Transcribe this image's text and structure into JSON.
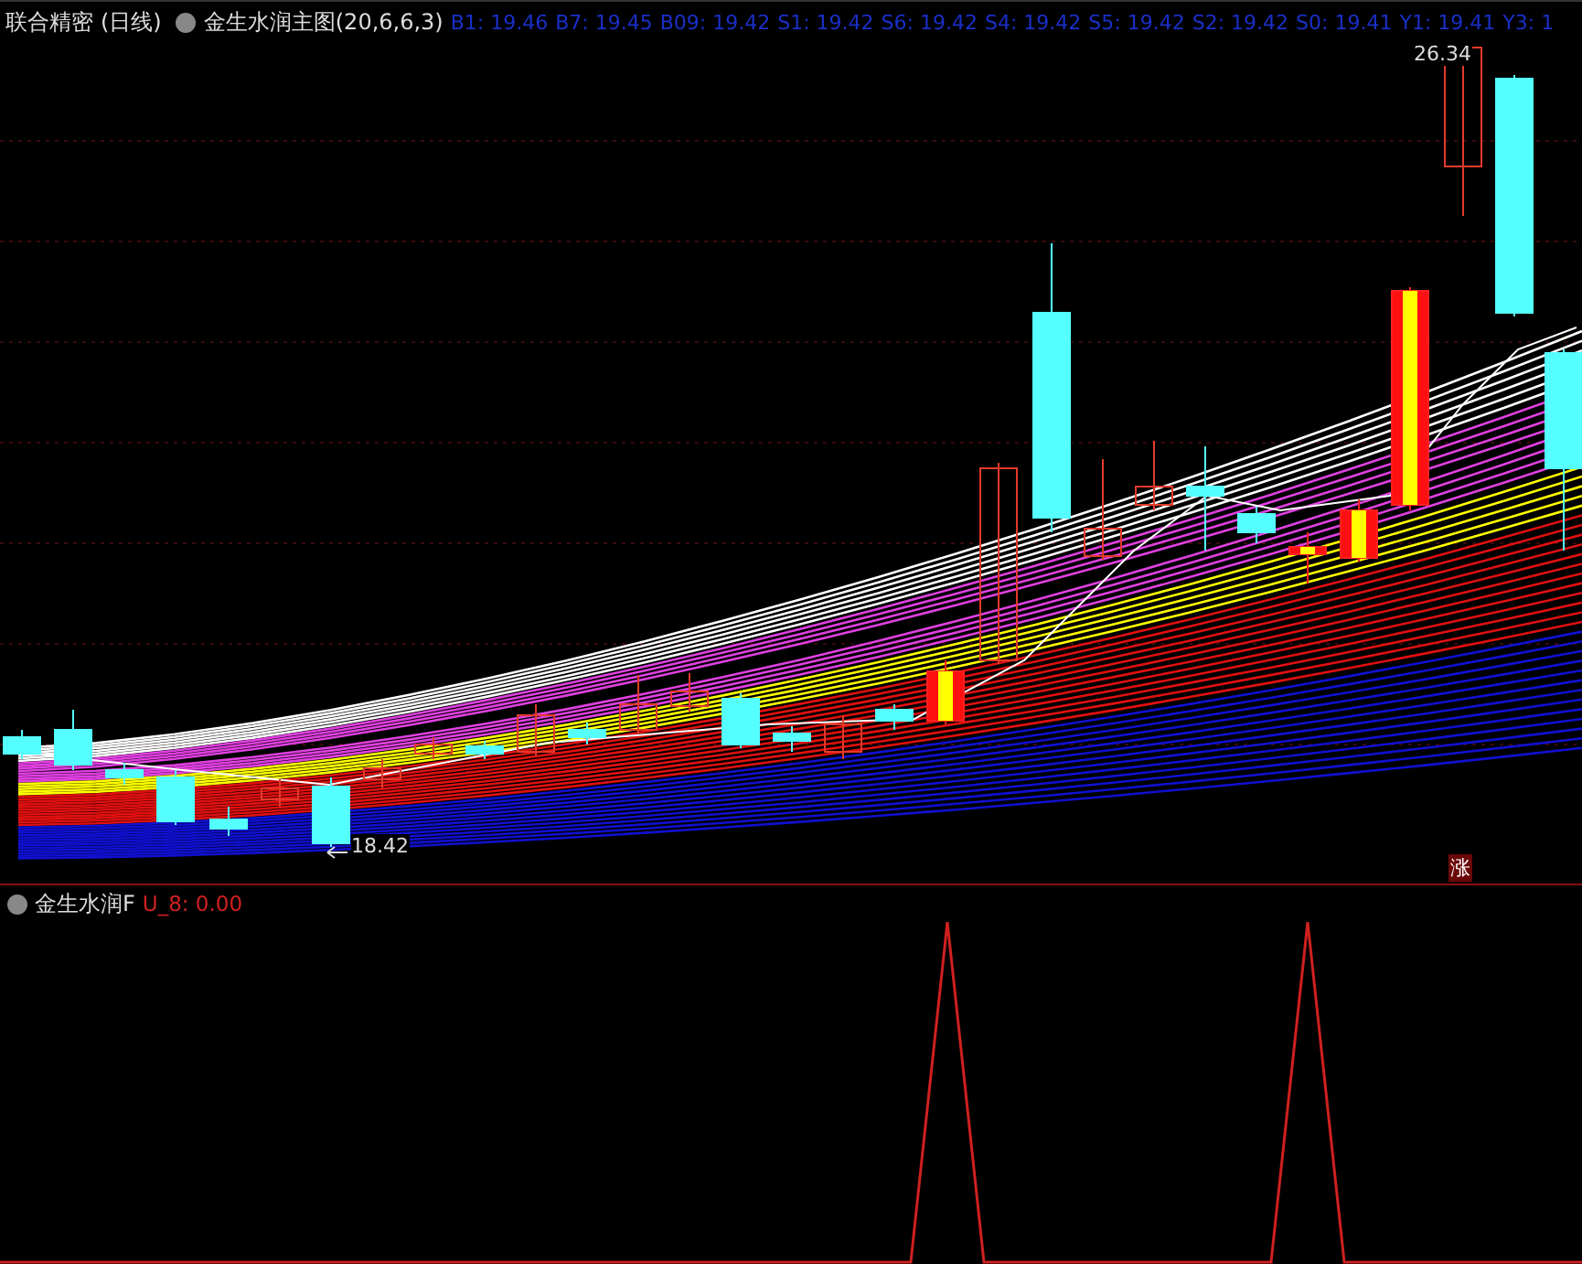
{
  "main_panel": {
    "stock": "联合精密",
    "period": "(日线)",
    "indicator": "金生水润主图",
    "params": "(20,6,6,3)",
    "readouts": [
      "B1: 19.46",
      "B7: 19.45",
      "B09: 19.42",
      "S1: 19.42",
      "S6: 19.42",
      "S4: 19.42",
      "S5: 19.42",
      "S2: 19.42",
      "S0: 19.41",
      "Y1: 19.41",
      "Y3: 1"
    ],
    "high_label": "26.34",
    "low_label": "18.42",
    "badge": "涨"
  },
  "sub_panel": {
    "indicator": "金生水润F",
    "reading": "U_8: 0.00"
  }
}
